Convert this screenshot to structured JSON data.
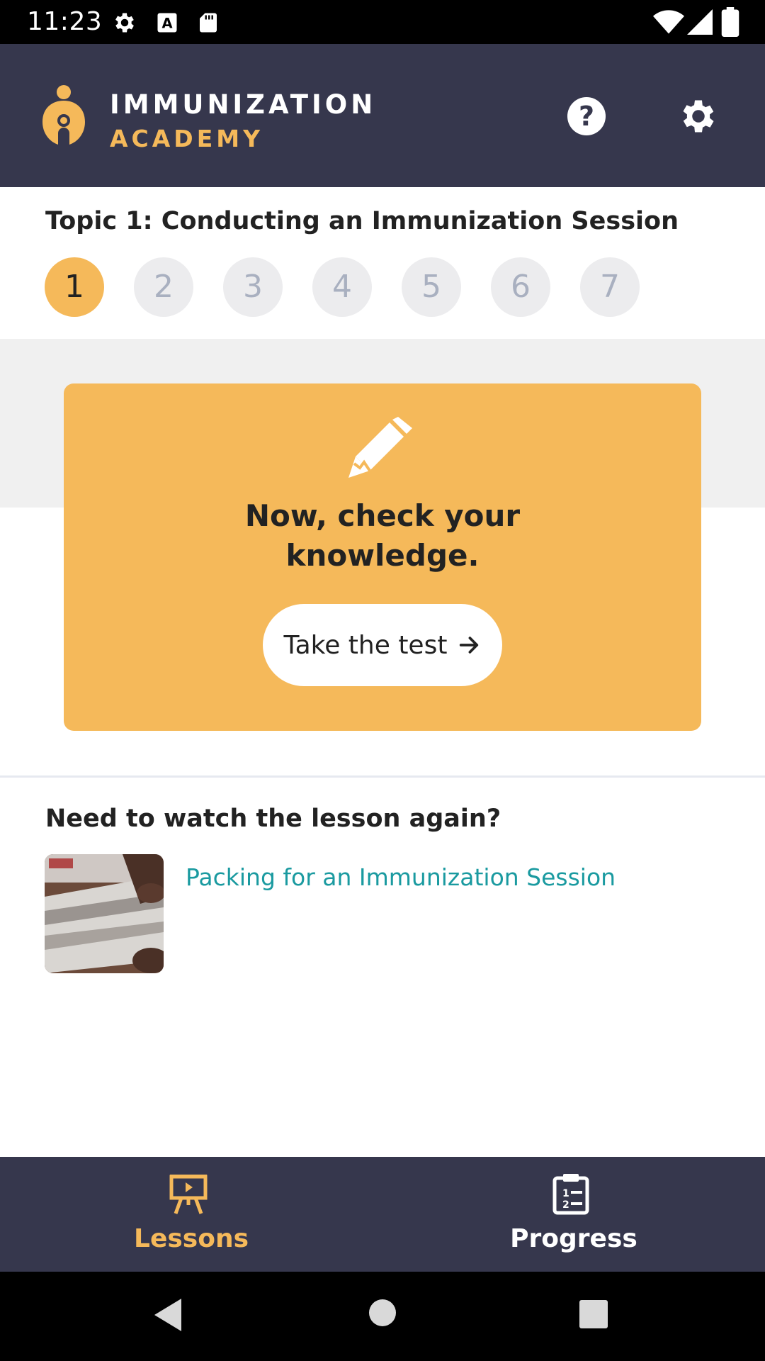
{
  "status_bar": {
    "time": "11:23",
    "icons": [
      "gear-icon",
      "text-a-icon",
      "sd-card-icon",
      "wifi-icon",
      "signal-icon",
      "battery-icon"
    ]
  },
  "header": {
    "brand_line1": "IMMUNIZATION",
    "brand_line2": "ACADEMY",
    "icons": [
      "help-icon",
      "settings-icon"
    ],
    "colors": {
      "background": "#36374d",
      "accent": "#f5b95a"
    }
  },
  "topic": {
    "title": "Topic 1: Conducting an Immunization Session",
    "steps": [
      "1",
      "2",
      "3",
      "4",
      "5",
      "6",
      "7"
    ],
    "active_step": "1"
  },
  "quiz_card": {
    "icon": "pencil-icon",
    "heading_line1": "Now, check your",
    "heading_line2": "knowledge.",
    "button_label": "Take the test",
    "button_icon": "arrow-right-icon"
  },
  "rewatch": {
    "title": "Need to watch the lesson again?",
    "lesson_title": "Packing for an Immunization Session"
  },
  "bottom_nav": {
    "items": [
      {
        "label": "Lessons",
        "icon": "presentation-easel-icon",
        "active": true
      },
      {
        "label": "Progress",
        "icon": "clipboard-list-icon",
        "active": false
      }
    ]
  },
  "system_nav": [
    "back-icon",
    "home-icon",
    "recents-icon"
  ]
}
